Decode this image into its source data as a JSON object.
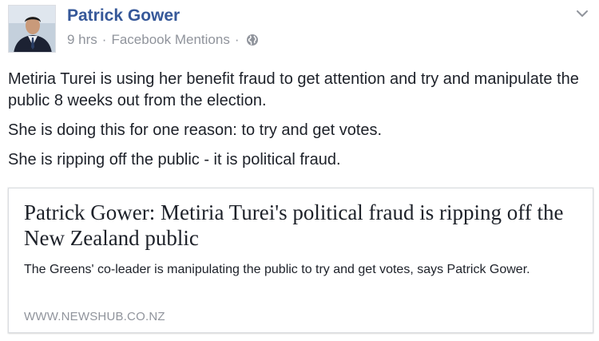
{
  "post": {
    "author": "Patrick Gower",
    "timestamp": "9 hrs",
    "separator": "·",
    "source": "Facebook Mentions",
    "privacy_icon": "globe-icon",
    "menu_icon": "chevron-down-icon",
    "paragraphs": [
      "Metiria Turei is using her benefit fraud to get attention and try and manipulate the public 8 weeks out from the election.",
      "She is doing this for one reason: to try and get votes.",
      "She is ripping off the public - it is political fraud."
    ]
  },
  "link_card": {
    "title": "Patrick Gower: Metiria Turei's political fraud is ripping off the New Zealand public",
    "description": "The Greens' co-leader is manipulating the public to try and get votes, says Patrick Gower.",
    "domain": "WWW.NEWSHUB.CO.NZ"
  },
  "colors": {
    "author_link": "#365899",
    "meta_text": "#90949c",
    "body_text": "#1d2129",
    "card_border": "#dadde1"
  }
}
